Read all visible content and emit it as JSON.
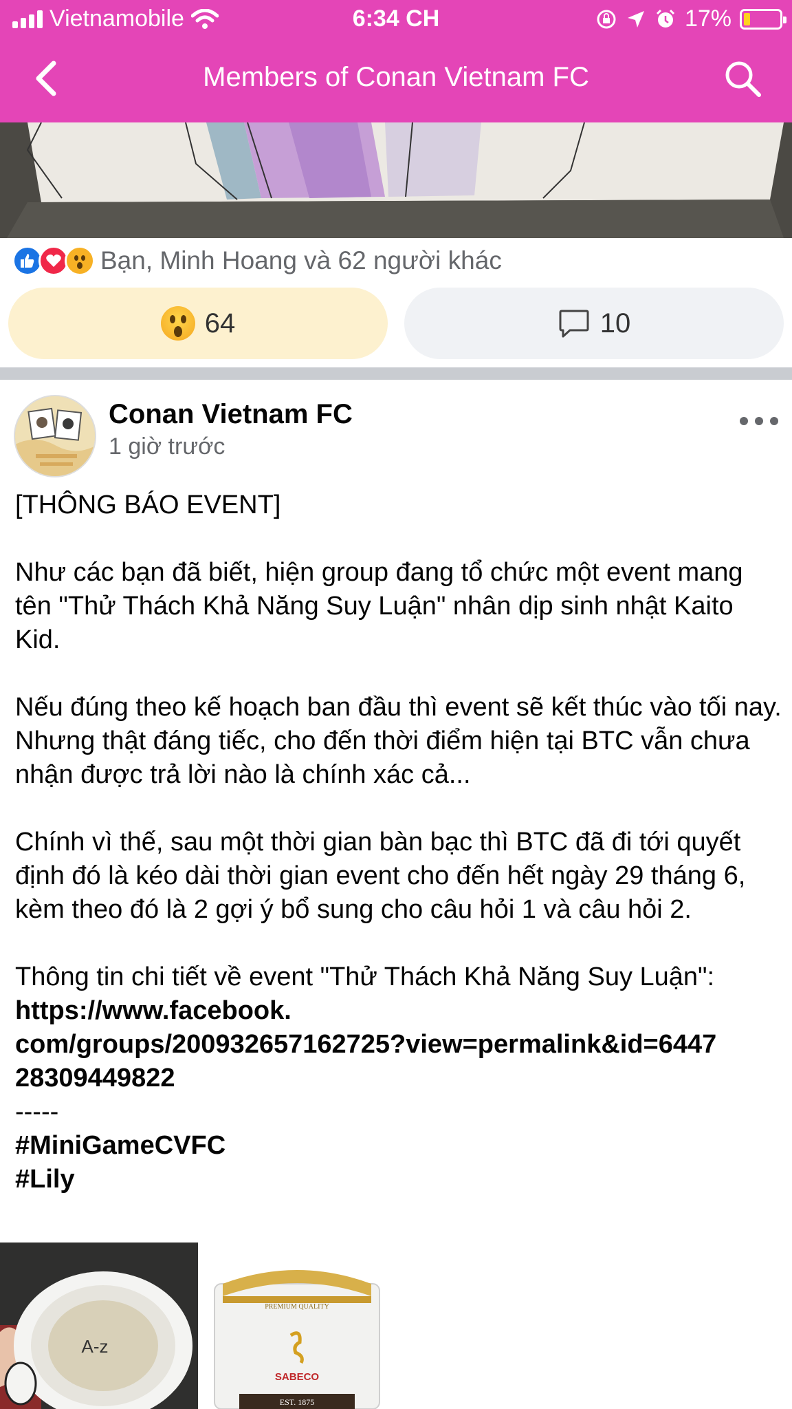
{
  "status_bar": {
    "carrier": "Vietnamobile",
    "time": "6:34 CH",
    "battery": "17%",
    "battery_level": 0.17
  },
  "nav": {
    "title": "Members of Conan Vietnam FC",
    "back_icon": "chevron-left-icon",
    "search_icon": "search-icon"
  },
  "colors": {
    "header": "#e445b7",
    "react_button": "#fdf1cf",
    "comment_button": "#f0f2f5",
    "separator": "#c9ccd1",
    "secondary_text": "#65676b"
  },
  "prev_post": {
    "reactions_summary": "Bạn, Minh Hoang và 62 người khác",
    "reaction_icons": [
      "like-icon",
      "love-icon",
      "wow-icon"
    ],
    "react_count": "64",
    "comment_count": "10"
  },
  "post": {
    "author": "Conan Vietnam FC",
    "time": "1 giờ trước",
    "heading": "[THÔNG BÁO EVENT]",
    "para1": "Như các bạn đã biết, hiện group đang tổ chức một event mang tên \"Thử Thách Khả Năng Suy Luận\" nhân dịp sinh nhật Kaito Kid.",
    "para2": "Nếu đúng theo kế hoạch ban đầu thì event sẽ kết thúc vào tối nay. Nhưng thật đáng tiếc, cho đến thời điểm hiện tại BTC vẫn chưa nhận được trả lời nào là chính xác cả...",
    "para3": "Chính vì thế, sau một thời gian bàn bạc thì BTC đã đi tới quyết định đó là kéo dài thời gian event cho đến hết ngày 29 tháng 6, kèm theo đó là 2 gợi ý bổ sung cho câu hỏi 1 và câu hỏi 2.",
    "para4": "Thông tin chi tiết về event \"Thử Thách Khả Năng Suy Luận\":",
    "link_line1": "https://www.facebook.",
    "link_line2": "com/groups/200932657162725?view=permalink&id=6447",
    "link_line3": "28309449822",
    "divider": "-----",
    "hashtag1": "#MiniGameCVFC",
    "hashtag2": "#Lily"
  },
  "images": {
    "cup_text": "A-z",
    "can_brand": "SABECO",
    "can_top": "PREMIUM QUALITY",
    "can_est": "EST. 1875"
  }
}
